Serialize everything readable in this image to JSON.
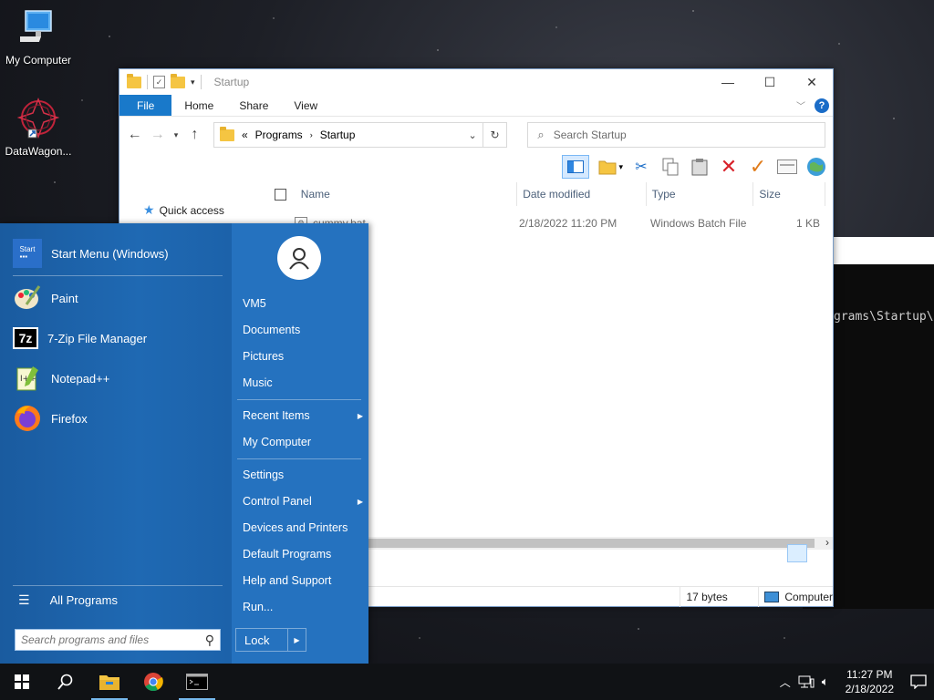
{
  "desktop": {
    "icons": [
      {
        "label": "My Computer",
        "icon": "computer-icon"
      },
      {
        "label": "DataWagon...",
        "icon": "datawagon-icon"
      }
    ]
  },
  "console": {
    "visible_text": "grams\\Startup\\"
  },
  "explorer": {
    "title": "Startup",
    "ribbon_tabs": [
      "File",
      "Home",
      "Share",
      "View"
    ],
    "address": {
      "prefix": "«",
      "crumbs": [
        "Programs",
        "Startup"
      ]
    },
    "search_placeholder": "Search Startup",
    "nav": {
      "quick_access": "Quick access"
    },
    "columns": [
      "Name",
      "Date modified",
      "Type",
      "Size"
    ],
    "files": [
      {
        "name": "cummy.bat",
        "date": "2/18/2022 11:20 PM",
        "type": "Windows Batch File",
        "size": "1 KB"
      }
    ],
    "status": {
      "selection_size": "17 bytes",
      "location": "Computer"
    }
  },
  "start_menu": {
    "pinned": [
      {
        "label": "Start Menu (Windows)",
        "icon": "start-menu-app-icon"
      },
      {
        "label": "Paint",
        "icon": "paint-icon"
      },
      {
        "label": "7-Zip File Manager",
        "icon": "7zip-icon"
      },
      {
        "label": "Notepad++",
        "icon": "notepadpp-icon"
      },
      {
        "label": "Firefox",
        "icon": "firefox-icon"
      }
    ],
    "all_programs": "All Programs",
    "search_placeholder": "Search programs and files",
    "user": "VM5",
    "right_items": [
      "Documents",
      "Pictures",
      "Music",
      "Recent Items",
      "My Computer",
      "Settings",
      "Control Panel",
      "Devices and Printers",
      "Default Programs",
      "Help and Support",
      "Run..."
    ],
    "lock_label": "Lock"
  },
  "taskbar": {
    "time": "11:27 PM",
    "date": "2/18/2022"
  },
  "colors": {
    "accent": "#1979ca",
    "start_menu_bg": "#1f6db8",
    "taskbar": "#101215"
  }
}
